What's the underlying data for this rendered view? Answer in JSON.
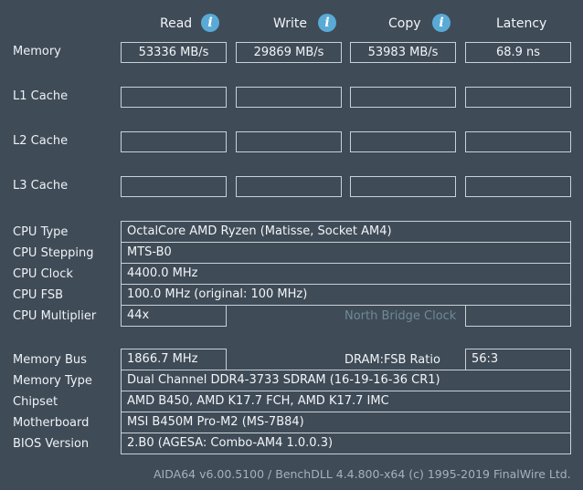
{
  "columns": {
    "read": "Read",
    "write": "Write",
    "copy": "Copy",
    "latency": "Latency",
    "info_glyph": "i"
  },
  "rows": {
    "memory": {
      "label": "Memory",
      "read": "53336 MB/s",
      "write": "29869 MB/s",
      "copy": "53983 MB/s",
      "latency": "68.9 ns"
    },
    "l1": {
      "label": "L1 Cache"
    },
    "l2": {
      "label": "L2 Cache"
    },
    "l3": {
      "label": "L3 Cache"
    }
  },
  "cpu": {
    "type_label": "CPU Type",
    "type_value": "OctalCore AMD Ryzen  (Matisse, Socket AM4)",
    "stepping_label": "CPU Stepping",
    "stepping_value": "MTS-B0",
    "clock_label": "CPU Clock",
    "clock_value": "4400.0 MHz",
    "fsb_label": "CPU FSB",
    "fsb_value": "100.0 MHz  (original: 100 MHz)",
    "multiplier_label": "CPU Multiplier",
    "multiplier_value": "44x",
    "nb_clock_label": "North Bridge Clock",
    "nb_clock_value": ""
  },
  "memory_info": {
    "bus_label": "Memory Bus",
    "bus_value": "1866.7 MHz",
    "ratio_label": "DRAM:FSB Ratio",
    "ratio_value": "56:3",
    "type_label": "Memory Type",
    "type_value": "Dual Channel DDR4-3733 SDRAM  (16-19-16-36 CR1)",
    "chipset_label": "Chipset",
    "chipset_value": "AMD B450, AMD K17.7 FCH, AMD K17.7 IMC",
    "motherboard_label": "Motherboard",
    "motherboard_value": "MSI B450M Pro-M2 (MS-7B84)",
    "bios_label": "BIOS Version",
    "bios_value": "2.B0  (AGESA: Combo-AM4 1.0.0.3)"
  },
  "footer": {
    "text": "AIDA64 v6.00.5100 / BenchDLL 4.4.800-x64  (c) 1995-2019 FinalWire Ltd."
  },
  "colors": {
    "background": "#3f4b57",
    "border": "#c9d1d8",
    "info_icon": "#5aaad6",
    "dim_text": "#6f8a96"
  }
}
